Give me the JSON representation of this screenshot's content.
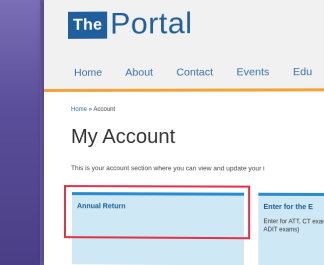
{
  "logo": {
    "box_text": "The",
    "name": "Portal"
  },
  "nav": [
    {
      "label": "Home"
    },
    {
      "label": "About"
    },
    {
      "label": "Contact"
    },
    {
      "label": "Events"
    },
    {
      "label": "Edu"
    }
  ],
  "breadcrumb": {
    "home": "Home",
    "separator": " » ",
    "current": "Account"
  },
  "page": {
    "title": "My Account",
    "intro": "This is your account section where you can view and update your i"
  },
  "cards": {
    "annual_return": {
      "title": "Annual Return"
    },
    "enter_exams": {
      "title": "Enter for the E",
      "description": "Enter for ATT, CT exams, or any AI ADIT exams)"
    }
  },
  "colors": {
    "brand_blue": "#1f5f9e",
    "accent_orange": "#f5a23a",
    "card_bg": "#cfe8f6",
    "highlight_red": "#e0324a"
  }
}
